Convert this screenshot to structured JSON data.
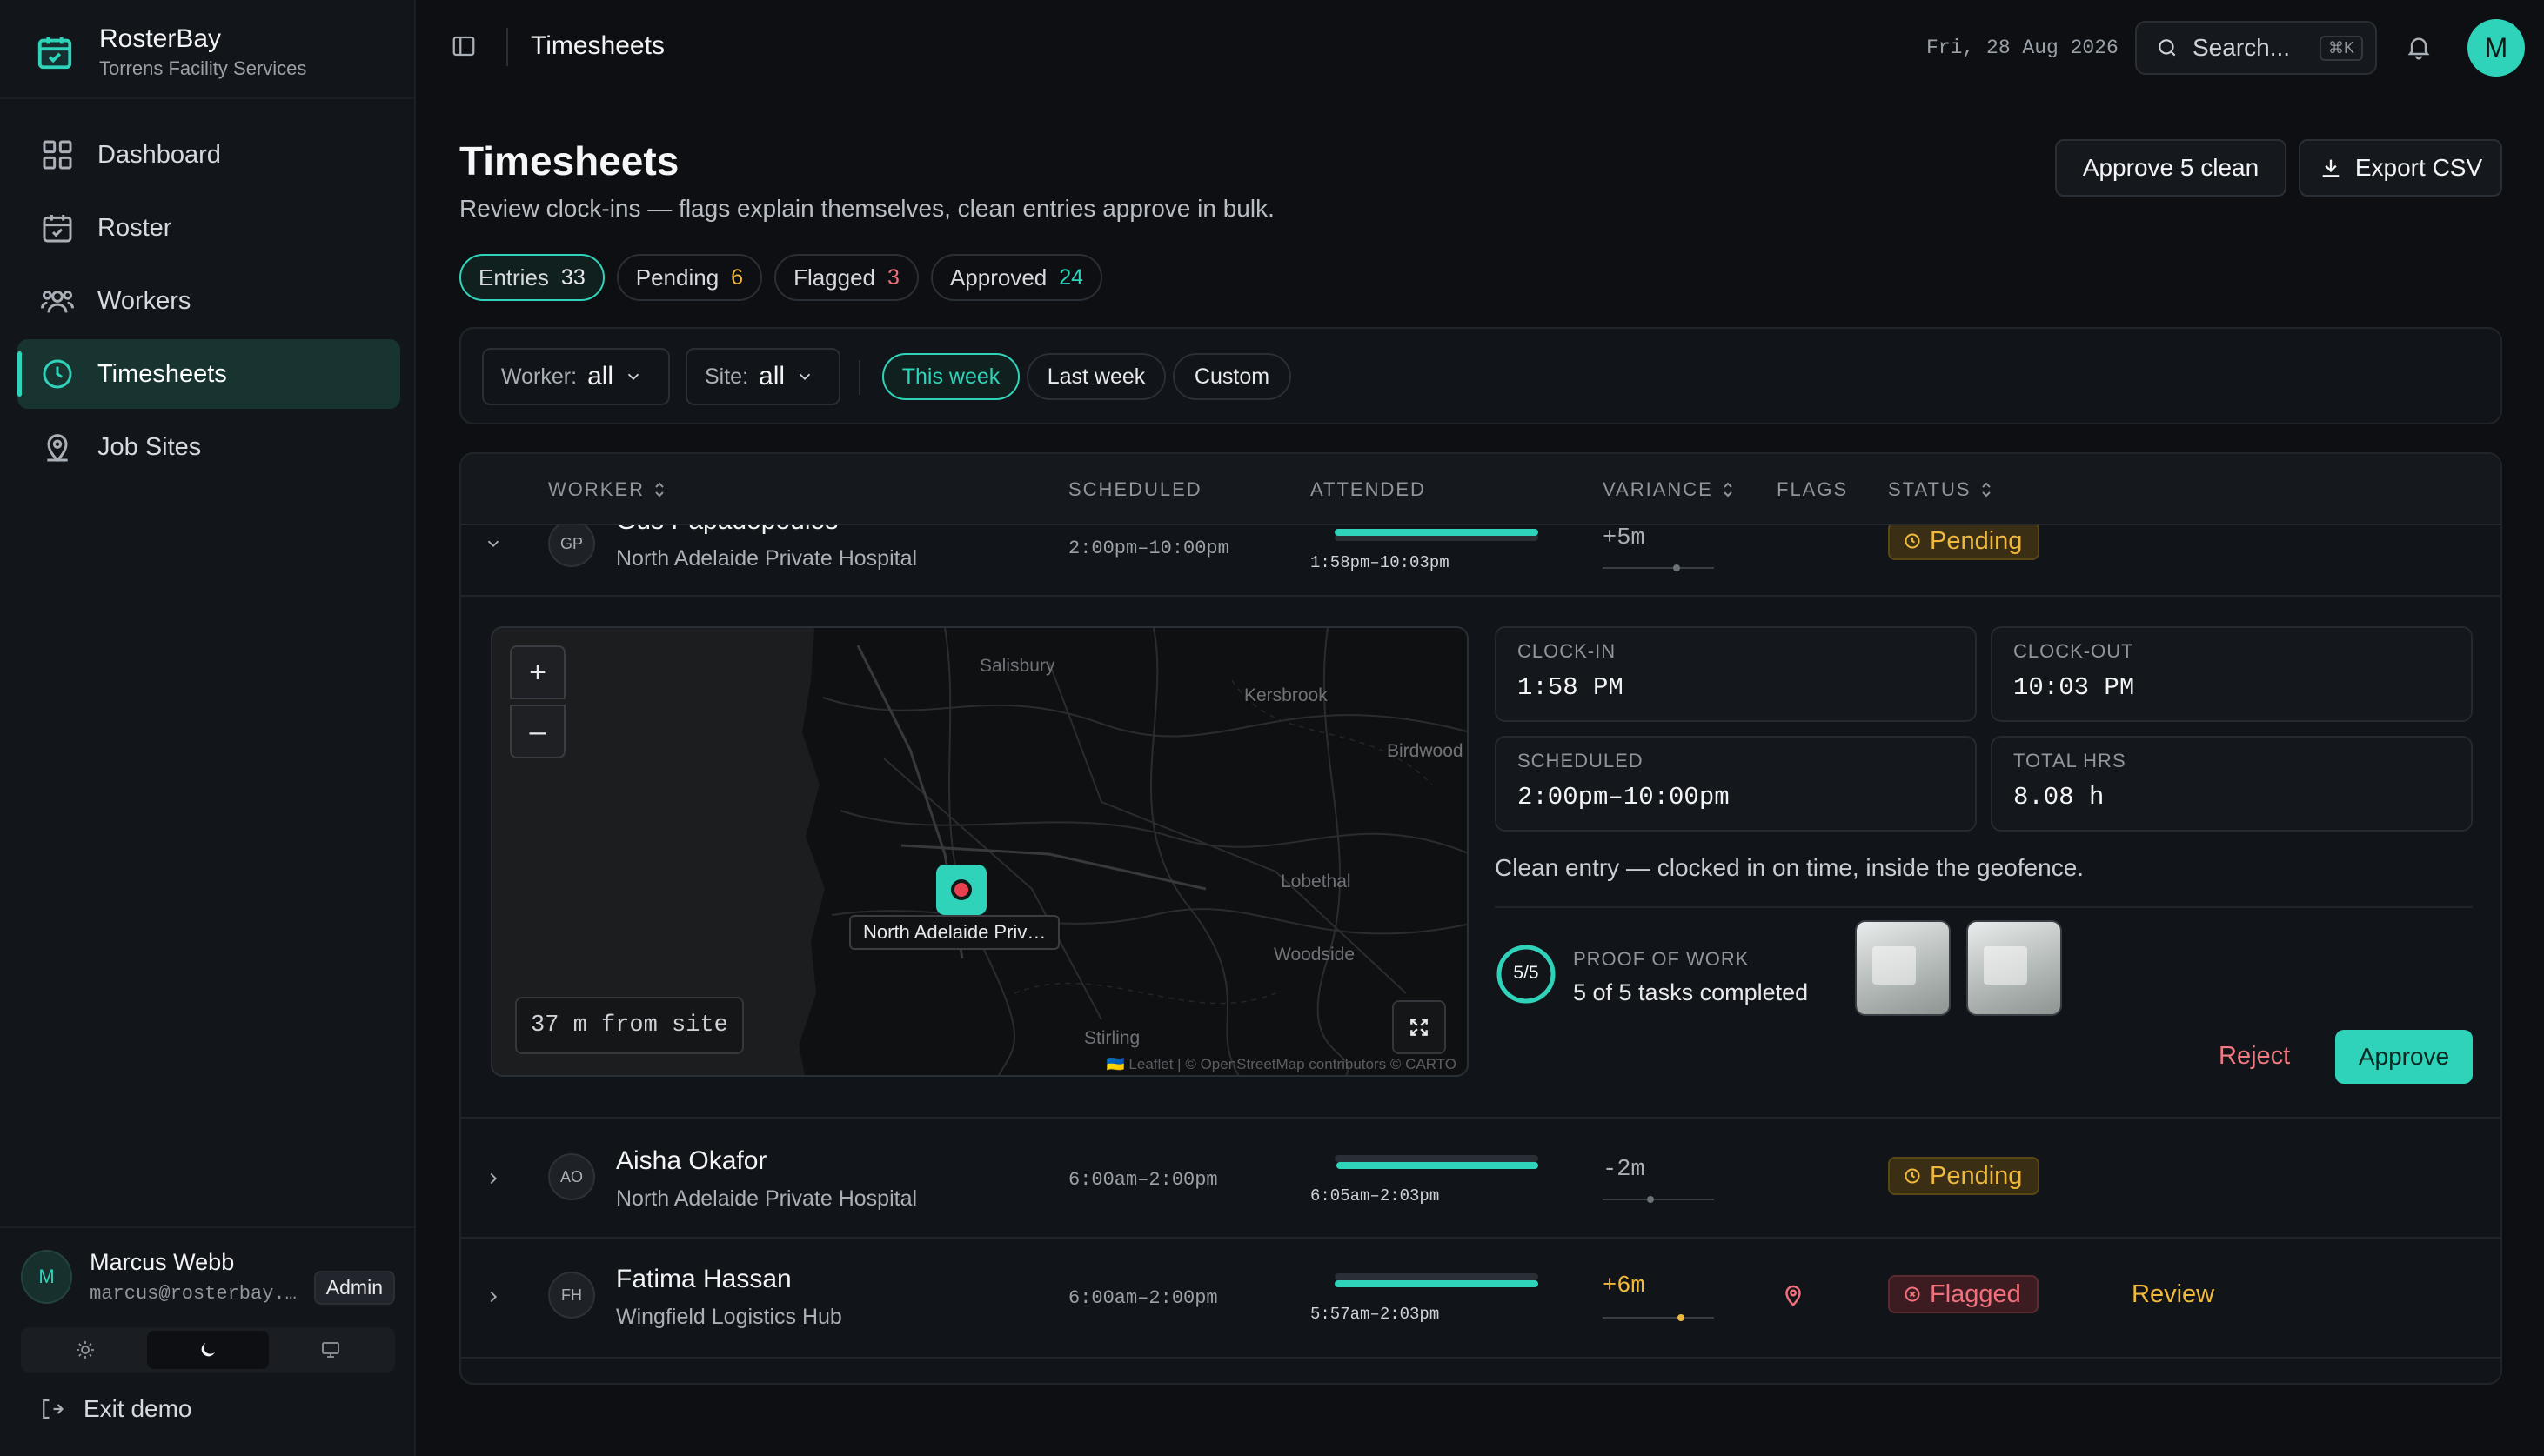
{
  "app": {
    "name": "RosterBay",
    "org": "Torrens Facility Services"
  },
  "nav": [
    {
      "label": "Dashboard",
      "icon": "dashboard-icon"
    },
    {
      "label": "Roster",
      "icon": "calendar-icon"
    },
    {
      "label": "Workers",
      "icon": "users-icon"
    },
    {
      "label": "Timesheets",
      "icon": "clock-icon",
      "active": true
    },
    {
      "label": "Job Sites",
      "icon": "map-pin-icon"
    }
  ],
  "user": {
    "initial": "M",
    "name": "Marcus Webb",
    "email": "marcus@rosterbay.…",
    "role": "Admin"
  },
  "theme_options": [
    "light",
    "dark",
    "system"
  ],
  "theme_selected": "dark",
  "exit_label": "Exit demo",
  "topbar": {
    "title": "Timesheets",
    "date": "Fri, 28 Aug 2026",
    "search_placeholder": "Search...",
    "search_shortcut": "⌘K",
    "avatar_initial": "M"
  },
  "page": {
    "title": "Timesheets",
    "subtitle": "Review clock-ins — flags explain themselves, clean entries approve in bulk.",
    "approve_btn": "Approve 5 clean",
    "export_btn": "Export CSV"
  },
  "tabs": [
    {
      "label": "Entries",
      "count": "33",
      "color": "#e7e9ec",
      "active": true
    },
    {
      "label": "Pending",
      "count": "6",
      "color": "#f1b93c"
    },
    {
      "label": "Flagged",
      "count": "3",
      "color": "#f0707c"
    },
    {
      "label": "Approved",
      "count": "24",
      "color": "#2fd3b9"
    }
  ],
  "filters": {
    "worker_label": "Worker:",
    "worker_value": "all",
    "site_label": "Site:",
    "site_value": "all",
    "ranges": [
      "This week",
      "Last week",
      "Custom"
    ],
    "range_selected": "This week"
  },
  "table": {
    "headers": {
      "worker": "WORKER",
      "scheduled": "SCHEDULED",
      "attended": "ATTENDED",
      "variance": "VARIANCE",
      "flags": "FLAGS",
      "status": "STATUS"
    },
    "rows": [
      {
        "initials": "GP",
        "name": "Gus Papadopoulos",
        "site": "North Adelaide Private Hospital",
        "scheduled": "2:00pm–10:00pm",
        "attended": "1:58pm–10:03pm",
        "variance": "+5m",
        "variance_minutes": 5,
        "status": "Pending",
        "expanded": true
      },
      {
        "initials": "AO",
        "name": "Aisha Okafor",
        "site": "North Adelaide Private Hospital",
        "scheduled": "6:00am–2:00pm",
        "attended": "6:05am–2:03pm",
        "variance": "-2m",
        "variance_minutes": -2,
        "status": "Pending"
      },
      {
        "initials": "FH",
        "name": "Fatima Hassan",
        "site": "Wingfield Logistics Hub",
        "scheduled": "6:00am–2:00pm",
        "attended": "5:57am–2:03pm",
        "variance": "+6m",
        "variance_minutes": 6,
        "flag_icon": "geofence-pin-icon",
        "status": "Flagged",
        "action": "Review"
      }
    ]
  },
  "detail": {
    "map": {
      "labels": [
        "Salisbury",
        "Kersbrook",
        "Birdwood",
        "Lobethal",
        "Woodside",
        "Stirling"
      ],
      "pin_label": "North Adelaide Priv…",
      "distance": "37 m from site",
      "attribution": "🇺🇦 Leaflet | © OpenStreetMap contributors © CARTO"
    },
    "clock_in_label": "CLOCK-IN",
    "clock_in": "1:58 PM",
    "clock_out_label": "CLOCK-OUT",
    "clock_out": "10:03 PM",
    "scheduled_label": "SCHEDULED",
    "scheduled": "2:00pm–10:00pm",
    "total_label": "TOTAL HRS",
    "total": "8.08 h",
    "note": "Clean entry — clocked in on time, inside the geofence.",
    "proof_ring": "5/5",
    "proof_label": "PROOF OF WORK",
    "proof_text": "5 of 5 tasks completed",
    "reject": "Reject",
    "approve": "Approve"
  },
  "colors": {
    "accent": "#2fd3b9",
    "pending": "#f1b93c",
    "flagged": "#f0707c"
  }
}
